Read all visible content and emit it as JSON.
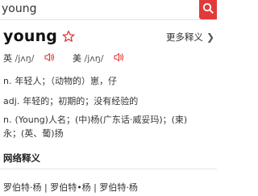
{
  "search": {
    "value": "young",
    "button_icon": "search-icon"
  },
  "entry": {
    "headword": "young",
    "star_icon": "star-icon",
    "more_label": "更多释义",
    "more_icon": "chevron-right-icon"
  },
  "phonetics": [
    {
      "label": "英",
      "ipa": "/jʌŋ/"
    },
    {
      "label": "美",
      "ipa": "/jʌŋ/"
    }
  ],
  "definitions": [
    {
      "pos": "n.",
      "text": "年轻人；（动物的）崽，仔"
    },
    {
      "pos": "adj.",
      "text": "年轻的；初期的；没有经验的"
    },
    {
      "pos": "n.",
      "text": "(Young)人名；(中)杨(广东话·威妥玛)；(柬)"
    },
    {
      "pos": "",
      "text": "永；(英、葡)扬"
    }
  ],
  "web": {
    "title": "网络释义",
    "line": "罗伯特·杨 | 罗伯特•杨 | 罗伯特·杨"
  },
  "colors": {
    "accent_red": "#e23a3a"
  }
}
